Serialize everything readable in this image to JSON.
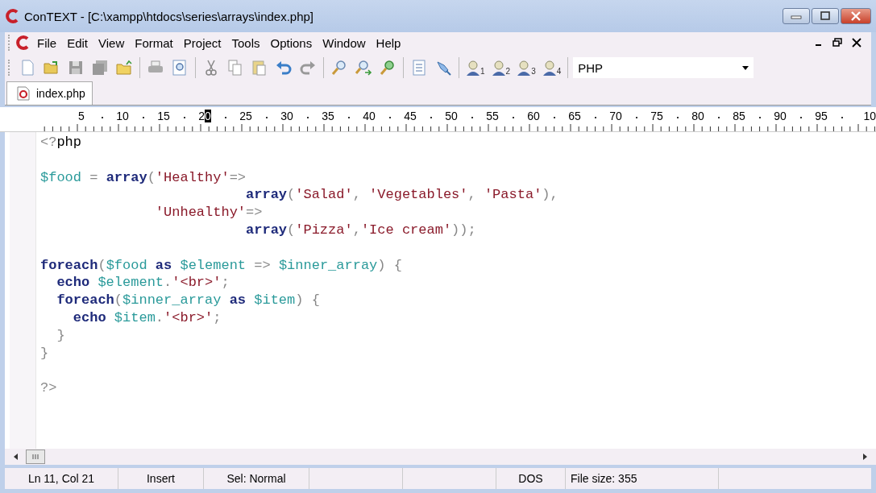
{
  "window": {
    "title": "ConTEXT - [C:\\xampp\\htdocs\\series\\arrays\\index.php]"
  },
  "menu": [
    "File",
    "Edit",
    "View",
    "Format",
    "Project",
    "Tools",
    "Options",
    "Window",
    "Help"
  ],
  "toolbar": {
    "user_buttons": [
      "1",
      "2",
      "3",
      "4"
    ],
    "highlighter": {
      "value": "PHP"
    }
  },
  "tabs": [
    {
      "label": "index.php",
      "selected": true
    }
  ],
  "ruler": [
    {
      "label": "5",
      "highlighted": false
    },
    {
      "label": "10",
      "highlighted": false
    },
    {
      "label": "15",
      "highlighted": false
    },
    {
      "label": "20",
      "highlighted": true
    },
    {
      "label": "25",
      "highlighted": false
    },
    {
      "label": "30",
      "highlighted": false
    },
    {
      "label": "35",
      "highlighted": false
    },
    {
      "label": "40",
      "highlighted": false
    },
    {
      "label": "45",
      "highlighted": false
    },
    {
      "label": "50",
      "highlighted": false
    },
    {
      "label": "55",
      "highlighted": false
    },
    {
      "label": "60",
      "highlighted": false
    },
    {
      "label": "65",
      "highlighted": false
    },
    {
      "label": "70",
      "highlighted": false
    },
    {
      "label": "75",
      "highlighted": false
    },
    {
      "label": "80",
      "highlighted": false
    },
    {
      "label": "85",
      "highlighted": false
    },
    {
      "label": "90",
      "highlighted": false
    },
    {
      "label": "95",
      "highlighted": false
    },
    {
      "label": "10",
      "highlighted": false
    }
  ],
  "code": [
    {
      "kind": "code",
      "tokens": [
        {
          "kind": "sym",
          "text": "<?"
        },
        {
          "kind": "plain",
          "text": "php"
        }
      ]
    },
    {
      "kind": "blank"
    },
    {
      "kind": "code",
      "tokens": [
        {
          "kind": "var",
          "text": "$food"
        },
        {
          "kind": "sym",
          "text": " = "
        },
        {
          "kind": "kw",
          "text": "array"
        },
        {
          "kind": "sym",
          "text": "("
        },
        {
          "kind": "str",
          "text": "'Healthy'"
        },
        {
          "kind": "sym",
          "text": "=>"
        }
      ]
    },
    {
      "kind": "code",
      "tokens": [
        {
          "kind": "kw",
          "text": "                         array"
        },
        {
          "kind": "sym",
          "text": "("
        },
        {
          "kind": "str",
          "text": "'Salad'"
        },
        {
          "kind": "sym",
          "text": ", "
        },
        {
          "kind": "str",
          "text": "'Vegetables'"
        },
        {
          "kind": "sym",
          "text": ", "
        },
        {
          "kind": "str",
          "text": "'Pasta'"
        },
        {
          "kind": "sym",
          "text": "),"
        }
      ]
    },
    {
      "kind": "code",
      "tokens": [
        {
          "kind": "str",
          "text": "              'Unhealthy'"
        },
        {
          "kind": "sym",
          "text": "=>"
        }
      ]
    },
    {
      "kind": "code",
      "tokens": [
        {
          "kind": "kw",
          "text": "                         array"
        },
        {
          "kind": "sym",
          "text": "("
        },
        {
          "kind": "str",
          "text": "'Pizza'"
        },
        {
          "kind": "sym",
          "text": ","
        },
        {
          "kind": "str",
          "text": "'Ice cream'"
        },
        {
          "kind": "sym",
          "text": "));"
        }
      ]
    },
    {
      "kind": "blank"
    },
    {
      "kind": "code",
      "tokens": [
        {
          "kind": "kw",
          "text": "foreach"
        },
        {
          "kind": "sym",
          "text": "("
        },
        {
          "kind": "var",
          "text": "$food"
        },
        {
          "kind": "kw",
          "text": " as "
        },
        {
          "kind": "var",
          "text": "$element"
        },
        {
          "kind": "sym",
          "text": " => "
        },
        {
          "kind": "var",
          "text": "$inner_array"
        },
        {
          "kind": "sym",
          "text": ") {"
        }
      ]
    },
    {
      "kind": "code",
      "tokens": [
        {
          "kind": "kw",
          "text": "  echo "
        },
        {
          "kind": "var",
          "text": "$element"
        },
        {
          "kind": "sym",
          "text": "."
        },
        {
          "kind": "str",
          "text": "'<br>'"
        },
        {
          "kind": "sym",
          "text": ";"
        }
      ]
    },
    {
      "kind": "code",
      "tokens": [
        {
          "kind": "kw",
          "text": "  foreach"
        },
        {
          "kind": "sym",
          "text": "("
        },
        {
          "kind": "var",
          "text": "$inner_array"
        },
        {
          "kind": "kw",
          "text": " as "
        },
        {
          "kind": "var",
          "text": "$item"
        },
        {
          "kind": "sym",
          "text": ") {"
        }
      ]
    },
    {
      "kind": "code",
      "tokens": [
        {
          "kind": "kw",
          "text": "    echo "
        },
        {
          "kind": "var",
          "text": "$item"
        },
        {
          "kind": "sym",
          "text": "."
        },
        {
          "kind": "str",
          "text": "'<br>'"
        },
        {
          "kind": "sym",
          "text": ";"
        }
      ]
    },
    {
      "kind": "code",
      "tokens": [
        {
          "kind": "sym",
          "text": "  }"
        }
      ]
    },
    {
      "kind": "code",
      "tokens": [
        {
          "kind": "sym",
          "text": "}"
        }
      ]
    },
    {
      "kind": "blank"
    },
    {
      "kind": "code",
      "tokens": [
        {
          "kind": "sym",
          "text": "?>"
        }
      ]
    }
  ],
  "status_bar": [
    "Ln 11, Col 21",
    "Insert",
    "Sel: Normal",
    "DOS",
    "File size: 355"
  ]
}
